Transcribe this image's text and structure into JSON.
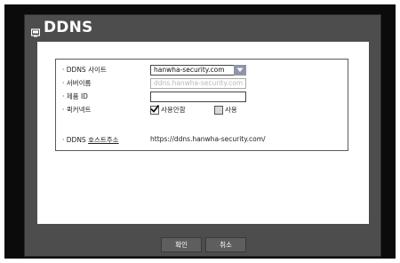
{
  "dialog": {
    "title": "DDNS"
  },
  "form": {
    "site_label": "· DDNS 사이트",
    "site_value": "hanwha-security.com",
    "server_label": "· 서버이름",
    "server_value": "ddns.hanwha-security.com",
    "product_id_label": "· 제품 ID",
    "product_id_value": "",
    "quick_connect_label": "· 퀵커넥트",
    "quick_connect_options": [
      {
        "label": "사용안함",
        "checked": true
      },
      {
        "label": "사용",
        "checked": false
      }
    ],
    "host_label_prefix": "· DDNS ",
    "host_label_underlined": "호스트주소",
    "host_value": "https://ddns.hanwha-security.com/"
  },
  "footer": {
    "ok_label": "확인",
    "cancel_label": "취소"
  },
  "colors": {
    "frame": "#0b0b0b",
    "dialog": "#4d4d4d",
    "select_button": "#8c96a8"
  },
  "icons": {
    "title": "monitor-icon",
    "select": "chevron-down-icon",
    "check": "checkmark-icon"
  }
}
